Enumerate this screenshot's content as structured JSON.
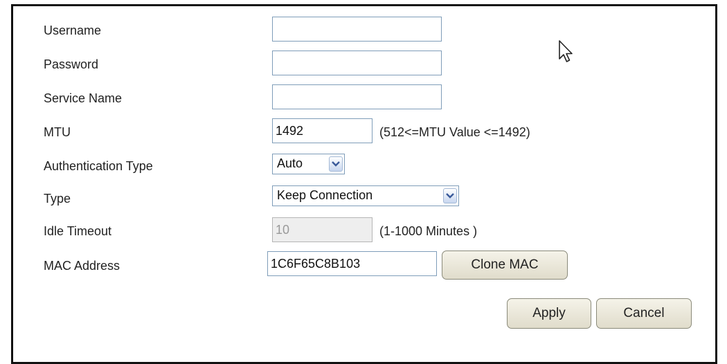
{
  "form": {
    "username": {
      "label": "Username",
      "value": ""
    },
    "password": {
      "label": "Password",
      "value": ""
    },
    "service_name": {
      "label": "Service Name",
      "value": ""
    },
    "mtu": {
      "label": "MTU",
      "value": "1492",
      "hint": "(512<=MTU Value <=1492)"
    },
    "auth_type": {
      "label": "Authentication Type",
      "selected": "Auto"
    },
    "type": {
      "label": "Type",
      "selected": "Keep Connection"
    },
    "idle_timeout": {
      "label": "Idle Timeout",
      "value": "10",
      "hint": "(1-1000 Minutes )"
    },
    "mac_address": {
      "label": "MAC Address",
      "value": "1C6F65C8B103",
      "clone_label": "Clone MAC"
    }
  },
  "actions": {
    "apply_label": "Apply",
    "cancel_label": "Cancel"
  },
  "icons": {
    "dropdown": "chevron-down-icon",
    "pointer": "mouse-pointer-icon"
  }
}
